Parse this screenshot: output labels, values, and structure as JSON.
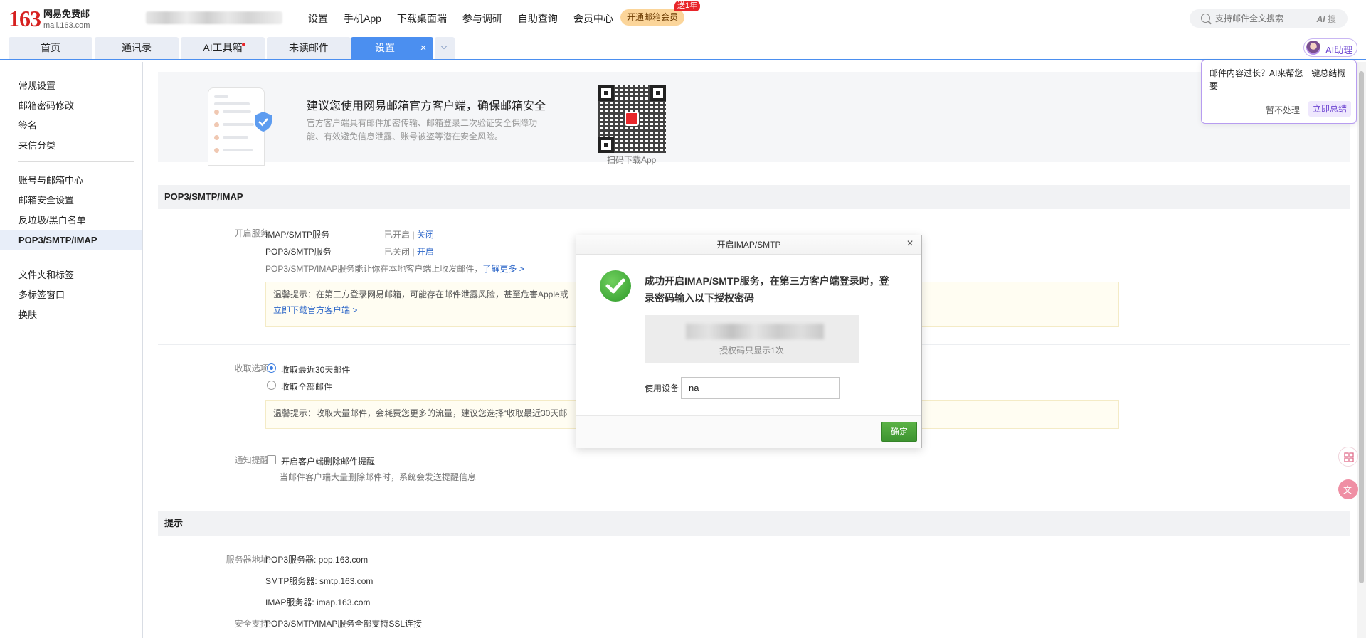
{
  "app": {
    "logo_number": "163",
    "logo_title": "网易免费邮",
    "logo_subtitle": "mail.163.com"
  },
  "topnav": {
    "items": [
      "设置",
      "手机App",
      "下载桌面端",
      "参与调研",
      "自助查询",
      "会员中心"
    ],
    "vip_button": "开通邮箱会员",
    "vip_badge": "送1年"
  },
  "search": {
    "placeholder": "支持邮件全文搜索",
    "ai_label": "AI",
    "ai_suffix": "搜"
  },
  "tabs": [
    {
      "label": "首页"
    },
    {
      "label": "通讯录"
    },
    {
      "label": "AI工具箱"
    },
    {
      "label": "未读邮件"
    },
    {
      "label": "设置"
    }
  ],
  "ai_helper": {
    "label": "AI助理"
  },
  "sidebar": {
    "group1": [
      "常规设置",
      "邮箱密码修改",
      "签名",
      "来信分类"
    ],
    "group2": [
      "账号与邮箱中心",
      "邮箱安全设置",
      "反垃圾/黑白名单",
      "POP3/SMTP/IMAP"
    ],
    "group3": [
      "文件夹和标签",
      "多标签窗口",
      "换肤"
    ]
  },
  "banner": {
    "title": "建议您使用网易邮箱官方客户端，确保邮箱安全",
    "desc": "官方客户端具有邮件加密传输、邮箱登录二次验证安全保障功能、有效避免信息泄露、账号被盗等潜在安全风险。",
    "qr_caption": "扫码下载App"
  },
  "pop3": {
    "section_title": "POP3/SMTP/IMAP",
    "services_label": "开启服务:",
    "service1_name": "IMAP/SMTP服务",
    "service1_status": "已开启",
    "service1_sep": "|",
    "service1_action": "关闭",
    "service2_name": "POP3/SMTP服务",
    "service2_status": "已关闭",
    "service2_sep": "|",
    "service2_action": "开启",
    "service_desc": "POP3/SMTP/IMAP服务能让你在本地客户端上收发邮件，",
    "learn_more": "了解更多 >",
    "tip1": "温馨提示：在第三方登录网易邮箱，可能存在邮件泄露风险，甚至危害Apple或",
    "tip1_link": "立即下载官方客户端 >",
    "receive_label": "收取选项:",
    "receive_opt1": "收取最近30天邮件",
    "receive_opt2": "收取全部邮件",
    "tip2": "温馨提示：收取大量邮件，会耗费您更多的流量，建议您选择“收取最近30天邮",
    "notify_label": "通知提醒:",
    "notify_opt": "开启客户端删除邮件提醒",
    "notify_desc": "当邮件客户端大量删除邮件时，系统会发送提醒信息"
  },
  "hints": {
    "section_title": "提示",
    "server_label": "服务器地址:",
    "pop3_server": "POP3服务器: pop.163.com",
    "smtp_server": "SMTP服务器: smtp.163.com",
    "imap_server": "IMAP服务器: imap.163.com",
    "security_label": "安全支持:",
    "security_desc": "POP3/SMTP/IMAP服务全部支持SSL连接"
  },
  "ai_popup": {
    "message": "邮件内容过长？AI来帮您一键总结概要",
    "dismiss": "暂不处理",
    "confirm": "立即总结"
  },
  "modal": {
    "title": "开启IMAP/SMTP",
    "close": "×",
    "message": "成功开启IMAP/SMTP服务，在第三方客户端登录时，登录密码输入以下授权密码",
    "code_note": "授权码只显示1次",
    "device_label": "使用设备",
    "device_value": "na",
    "ok_button": "确定"
  },
  "colors": {
    "brand_red": "#d6201f",
    "tab_active": "#4b8ff0",
    "link": "#2c66c8",
    "ok_green": "#3d9430",
    "ai_purple": "#6b42d1"
  }
}
